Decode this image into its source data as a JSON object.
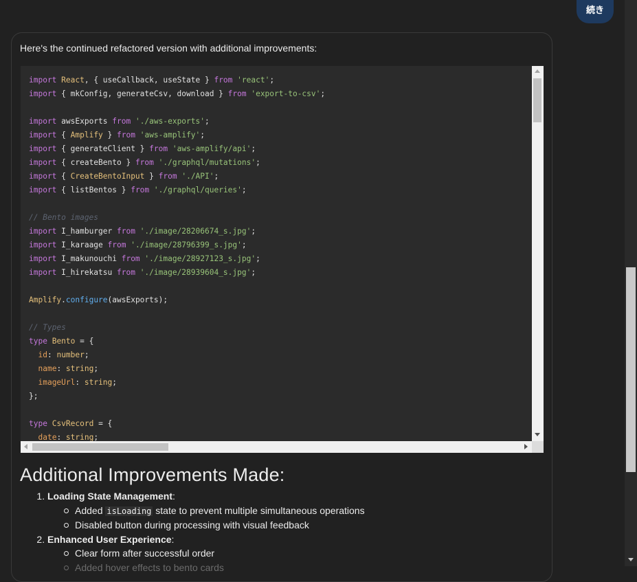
{
  "user_message": "続き",
  "assistant": {
    "intro": "Here's the continued refactored version with additional improvements:",
    "code_lines": [
      [
        {
          "t": "import",
          "c": "kw"
        },
        {
          "t": " "
        },
        {
          "t": "React",
          "c": "cls"
        },
        {
          "t": ", { useCallback, useState } "
        },
        {
          "t": "from",
          "c": "kw"
        },
        {
          "t": " "
        },
        {
          "t": "'react'",
          "c": "str"
        },
        {
          "t": ";"
        }
      ],
      [
        {
          "t": "import",
          "c": "kw"
        },
        {
          "t": " { mkConfig, generateCsv, download } "
        },
        {
          "t": "from",
          "c": "kw"
        },
        {
          "t": " "
        },
        {
          "t": "'export-to-csv'",
          "c": "str"
        },
        {
          "t": ";"
        }
      ],
      [],
      [
        {
          "t": "import",
          "c": "kw"
        },
        {
          "t": " awsExports "
        },
        {
          "t": "from",
          "c": "kw"
        },
        {
          "t": " "
        },
        {
          "t": "'./aws-exports'",
          "c": "str"
        },
        {
          "t": ";"
        }
      ],
      [
        {
          "t": "import",
          "c": "kw"
        },
        {
          "t": " { "
        },
        {
          "t": "Amplify",
          "c": "cls"
        },
        {
          "t": " } "
        },
        {
          "t": "from",
          "c": "kw"
        },
        {
          "t": " "
        },
        {
          "t": "'aws-amplify'",
          "c": "str"
        },
        {
          "t": ";"
        }
      ],
      [
        {
          "t": "import",
          "c": "kw"
        },
        {
          "t": " { generateClient } "
        },
        {
          "t": "from",
          "c": "kw"
        },
        {
          "t": " "
        },
        {
          "t": "'aws-amplify/api'",
          "c": "str"
        },
        {
          "t": ";"
        }
      ],
      [
        {
          "t": "import",
          "c": "kw"
        },
        {
          "t": " { createBento } "
        },
        {
          "t": "from",
          "c": "kw"
        },
        {
          "t": " "
        },
        {
          "t": "'./graphql/mutations'",
          "c": "str"
        },
        {
          "t": ";"
        }
      ],
      [
        {
          "t": "import",
          "c": "kw"
        },
        {
          "t": " { "
        },
        {
          "t": "CreateBentoInput",
          "c": "cls"
        },
        {
          "t": " } "
        },
        {
          "t": "from",
          "c": "kw"
        },
        {
          "t": " "
        },
        {
          "t": "'./API'",
          "c": "str"
        },
        {
          "t": ";"
        }
      ],
      [
        {
          "t": "import",
          "c": "kw"
        },
        {
          "t": " { listBentos } "
        },
        {
          "t": "from",
          "c": "kw"
        },
        {
          "t": " "
        },
        {
          "t": "'./graphql/queries'",
          "c": "str"
        },
        {
          "t": ";"
        }
      ],
      [],
      [
        {
          "t": "// Bento images",
          "c": "cm"
        }
      ],
      [
        {
          "t": "import",
          "c": "kw"
        },
        {
          "t": " I_hamburger "
        },
        {
          "t": "from",
          "c": "kw"
        },
        {
          "t": " "
        },
        {
          "t": "'./image/28206674_s.jpg'",
          "c": "str"
        },
        {
          "t": ";"
        }
      ],
      [
        {
          "t": "import",
          "c": "kw"
        },
        {
          "t": " I_karaage "
        },
        {
          "t": "from",
          "c": "kw"
        },
        {
          "t": " "
        },
        {
          "t": "'./image/28796399_s.jpg'",
          "c": "str"
        },
        {
          "t": ";"
        }
      ],
      [
        {
          "t": "import",
          "c": "kw"
        },
        {
          "t": " I_makunouchi "
        },
        {
          "t": "from",
          "c": "kw"
        },
        {
          "t": " "
        },
        {
          "t": "'./image/28927123_s.jpg'",
          "c": "str"
        },
        {
          "t": ";"
        }
      ],
      [
        {
          "t": "import",
          "c": "kw"
        },
        {
          "t": " I_hirekatsu "
        },
        {
          "t": "from",
          "c": "kw"
        },
        {
          "t": " "
        },
        {
          "t": "'./image/28939604_s.jpg'",
          "c": "str"
        },
        {
          "t": ";"
        }
      ],
      [],
      [
        {
          "t": "Amplify",
          "c": "cls"
        },
        {
          "t": "."
        },
        {
          "t": "configure",
          "c": "fn"
        },
        {
          "t": "(awsExports);"
        }
      ],
      [],
      [
        {
          "t": "// Types",
          "c": "cm"
        }
      ],
      [
        {
          "t": "type",
          "c": "kw"
        },
        {
          "t": " "
        },
        {
          "t": "Bento",
          "c": "cls"
        },
        {
          "t": " = {"
        }
      ],
      [
        {
          "t": "  "
        },
        {
          "t": "id",
          "c": "prop"
        },
        {
          "t": ": "
        },
        {
          "t": "number",
          "c": "cls"
        },
        {
          "t": ";"
        }
      ],
      [
        {
          "t": "  "
        },
        {
          "t": "name",
          "c": "prop"
        },
        {
          "t": ": "
        },
        {
          "t": "string",
          "c": "cls"
        },
        {
          "t": ";"
        }
      ],
      [
        {
          "t": "  "
        },
        {
          "t": "imageUrl",
          "c": "prop"
        },
        {
          "t": ": "
        },
        {
          "t": "string",
          "c": "cls"
        },
        {
          "t": ";"
        }
      ],
      [
        {
          "t": "};"
        }
      ],
      [],
      [
        {
          "t": "type",
          "c": "kw"
        },
        {
          "t": " "
        },
        {
          "t": "CsvRecord",
          "c": "cls"
        },
        {
          "t": " = {"
        }
      ],
      [
        {
          "t": "  "
        },
        {
          "t": "date",
          "c": "prop"
        },
        {
          "t": ": "
        },
        {
          "t": "string",
          "c": "cls"
        },
        {
          "t": ";"
        }
      ]
    ],
    "heading": "Additional Improvements Made:",
    "improvements": [
      {
        "title": "Loading State Management",
        "suffix": ":",
        "bullets": [
          {
            "before": "Added ",
            "code": "isLoading",
            "after": " state to prevent multiple simultaneous operations"
          },
          {
            "before": "Disabled button during processing with visual feedback",
            "code": "",
            "after": ""
          }
        ]
      },
      {
        "title": "Enhanced User Experience",
        "suffix": ":",
        "bullets": [
          {
            "before": "Clear form after successful order",
            "code": "",
            "after": ""
          },
          {
            "before": "Added hover effects to bento cards",
            "code": "",
            "after": "",
            "faded": true
          }
        ]
      }
    ]
  }
}
